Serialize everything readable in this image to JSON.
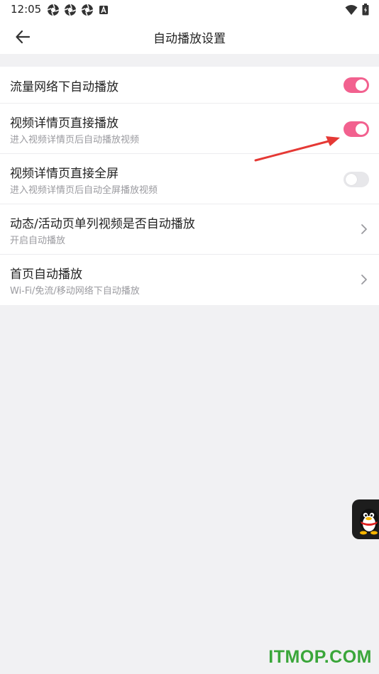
{
  "status_bar": {
    "time": "12:05",
    "left_icons": [
      "aperture-icon",
      "aperture-icon",
      "aperture-icon",
      "a-badge-icon"
    ],
    "right_icons": [
      "wifi-icon",
      "battery-icon"
    ]
  },
  "toolbar": {
    "title": "自动播放设置",
    "back_icon": "back-arrow-icon"
  },
  "settings": [
    {
      "title": "流量网络下自动播放",
      "subtitle": "",
      "control": "toggle",
      "state": "on"
    },
    {
      "title": "视频详情页直接播放",
      "subtitle": "进入视频详情页后自动播放视频",
      "control": "toggle",
      "state": "on"
    },
    {
      "title": "视频详情页直接全屏",
      "subtitle": "进入视频详情页后自动全屏播放视频",
      "control": "toggle",
      "state": "off"
    },
    {
      "title": "动态/活动页单列视频是否自动播放",
      "subtitle": "开启自动播放",
      "control": "chevron"
    },
    {
      "title": "首页自动播放",
      "subtitle": "Wi-Fi/免流/移动网络下自动播放",
      "control": "chevron"
    }
  ],
  "float_button": {
    "icon": "qq-penguin-icon"
  },
  "watermark": "ITMOP.COM",
  "colors": {
    "accent": "#f2618f",
    "toggle_off": "#e7e7ea",
    "background": "#f1f1f3",
    "annotation_arrow": "#e53935",
    "watermark": "#3aa63a"
  }
}
